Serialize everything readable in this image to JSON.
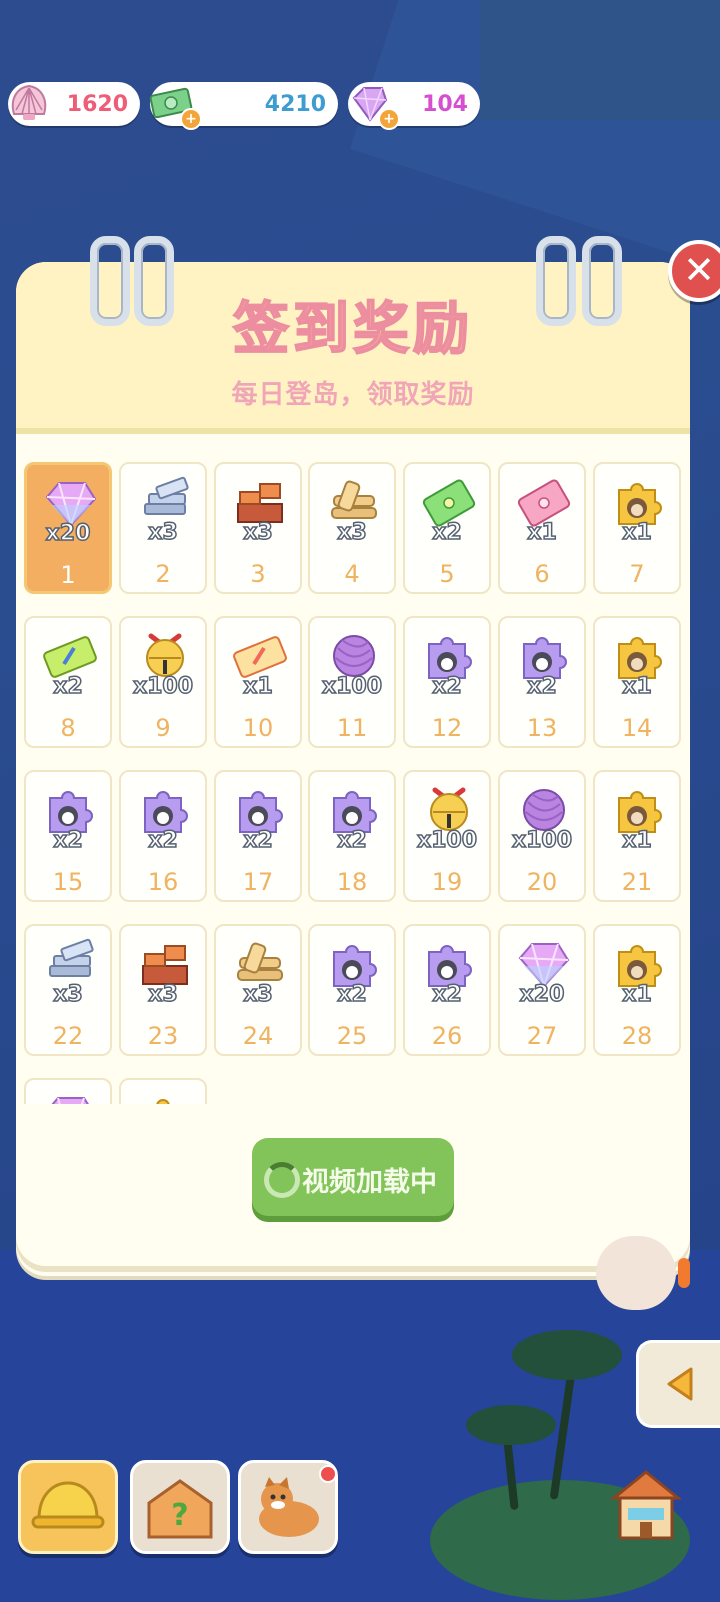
{
  "currencies": [
    {
      "name": "shells",
      "value": "1620",
      "color": "#ef5c78",
      "icon": "shell-icon"
    },
    {
      "name": "cash",
      "value": "4210",
      "color": "#3f9cd0",
      "icon": "money-icon"
    },
    {
      "name": "gems",
      "value": "104",
      "color": "#d64fd0",
      "icon": "gem-icon"
    }
  ],
  "panel": {
    "title": "签到奖励",
    "subtitle": "每日登岛，领取奖励",
    "close_icon": "close-icon"
  },
  "rewards": [
    {
      "day": "1",
      "qty": "x20",
      "item": "gem"
    },
    {
      "day": "2",
      "qty": "x3",
      "item": "steel"
    },
    {
      "day": "3",
      "qty": "x3",
      "item": "brick"
    },
    {
      "day": "4",
      "qty": "x3",
      "item": "wood"
    },
    {
      "day": "5",
      "qty": "x2",
      "item": "ticket-green"
    },
    {
      "day": "6",
      "qty": "x1",
      "item": "ticket-pink"
    },
    {
      "day": "7",
      "qty": "x1",
      "item": "puzzle-gold"
    },
    {
      "day": "8",
      "qty": "x2",
      "item": "ticket-lime"
    },
    {
      "day": "9",
      "qty": "x100",
      "item": "bell"
    },
    {
      "day": "10",
      "qty": "x1",
      "item": "ticket-orange"
    },
    {
      "day": "11",
      "qty": "x100",
      "item": "yarn"
    },
    {
      "day": "12",
      "qty": "x2",
      "item": "puzzle-purple"
    },
    {
      "day": "13",
      "qty": "x2",
      "item": "puzzle-purple"
    },
    {
      "day": "14",
      "qty": "x1",
      "item": "puzzle-gold"
    },
    {
      "day": "15",
      "qty": "x2",
      "item": "puzzle-purple"
    },
    {
      "day": "16",
      "qty": "x2",
      "item": "puzzle-purple"
    },
    {
      "day": "17",
      "qty": "x2",
      "item": "puzzle-purple"
    },
    {
      "day": "18",
      "qty": "x2",
      "item": "puzzle-purple"
    },
    {
      "day": "19",
      "qty": "x100",
      "item": "bell"
    },
    {
      "day": "20",
      "qty": "x100",
      "item": "yarn"
    },
    {
      "day": "21",
      "qty": "x1",
      "item": "puzzle-gold"
    },
    {
      "day": "22",
      "qty": "x3",
      "item": "steel"
    },
    {
      "day": "23",
      "qty": "x3",
      "item": "brick"
    },
    {
      "day": "24",
      "qty": "x3",
      "item": "wood"
    },
    {
      "day": "25",
      "qty": "x2",
      "item": "puzzle-purple"
    },
    {
      "day": "26",
      "qty": "x2",
      "item": "puzzle-purple"
    },
    {
      "day": "27",
      "qty": "x20",
      "item": "gem"
    },
    {
      "day": "28",
      "qty": "x1",
      "item": "puzzle-gold"
    },
    {
      "day": "",
      "qty": "",
      "item": "gem"
    },
    {
      "day": "",
      "qty": "",
      "item": "puzzle-gold"
    }
  ],
  "current_day_index": 0,
  "button": {
    "label": "视频加载中",
    "icon": "spinner-icon"
  },
  "bottom_nav": [
    {
      "name": "nav-build",
      "icon": "hardhat-icon",
      "selected": true
    },
    {
      "name": "nav-quest",
      "icon": "question-house-icon",
      "selected": false
    },
    {
      "name": "nav-pet",
      "icon": "dog-icon",
      "selected": false,
      "badge": true
    },
    {
      "name": "nav-shop",
      "icon": "shop-icon",
      "selected": false
    }
  ],
  "side_arrow_icon": "arrow-left-icon"
}
